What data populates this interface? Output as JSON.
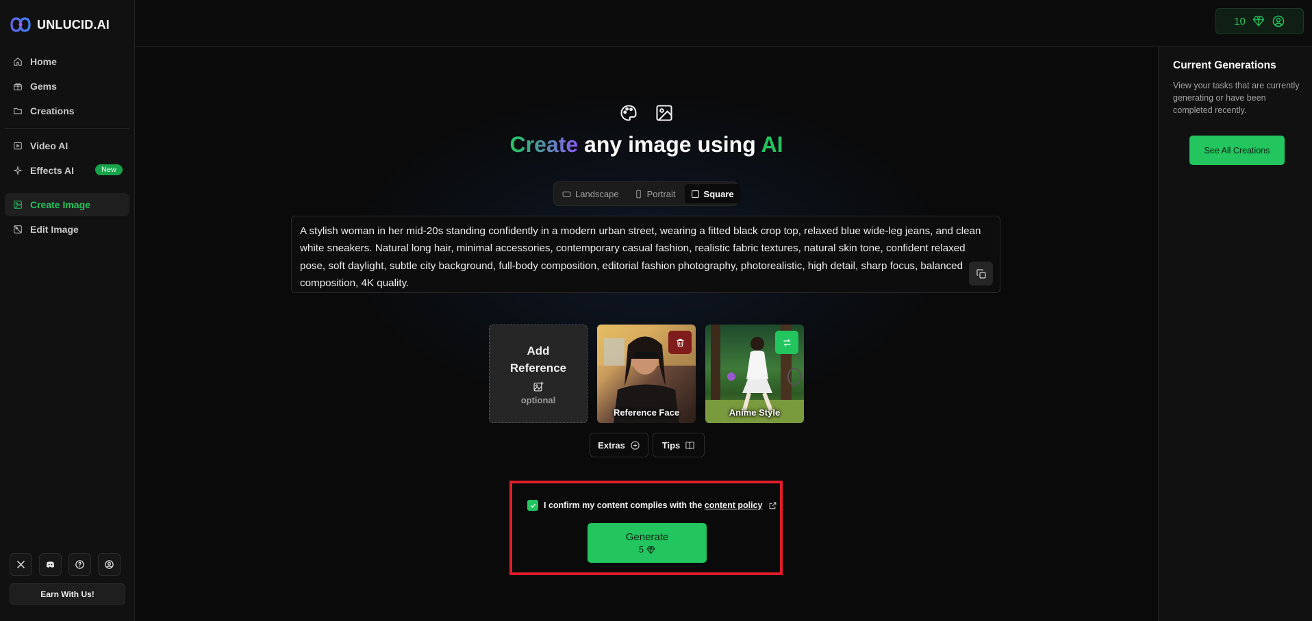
{
  "brand": {
    "name": "UNLUCID.AI"
  },
  "sidebar": {
    "items": [
      {
        "label": "Home",
        "icon": "home-icon"
      },
      {
        "label": "Gems",
        "icon": "gift-icon"
      },
      {
        "label": "Creations",
        "icon": "folder-icon"
      },
      {
        "label": "Video AI",
        "icon": "video-icon"
      },
      {
        "label": "Effects AI",
        "icon": "sparkles-icon",
        "badge": "New"
      },
      {
        "label": "Create Image",
        "icon": "image-plus-icon",
        "active": true
      },
      {
        "label": "Edit Image",
        "icon": "image-edit-icon"
      }
    ],
    "footer_icons": [
      "x-icon",
      "discord-icon",
      "help-icon",
      "user-icon"
    ],
    "earn_label": "Earn With Us!"
  },
  "topbar": {
    "gems_count": "10"
  },
  "main": {
    "headline": {
      "part1": "Create",
      "part2": " any image using ",
      "part3": "AI"
    },
    "aspect": {
      "options": [
        "Landscape",
        "Portrait",
        "Square"
      ],
      "selected": "Square"
    },
    "prompt": "A stylish woman in her mid-20s standing confidently in a modern urban street, wearing a fitted black crop top, relaxed blue wide-leg jeans, and clean white sneakers. Natural long hair, minimal accessories, contemporary casual fashion, realistic fabric textures, natural skin tone, confident relaxed pose, soft daylight, subtle city background, full-body composition, editorial fashion photography, photorealistic, high detail, sharp focus, balanced composition, 4K quality.",
    "reference": {
      "add_line1": "Add",
      "add_line2": "Reference",
      "optional": "optional"
    },
    "ref_cards": [
      {
        "label": "Reference Face"
      },
      {
        "label": "Anime Style"
      }
    ],
    "extras_label": "Extras",
    "tips_label": "Tips",
    "confirm": {
      "checked": true,
      "text": "I confirm my content complies with the ",
      "link": "content policy"
    },
    "generate": {
      "label": "Generate",
      "cost": "5"
    }
  },
  "right_panel": {
    "title": "Current Generations",
    "description": "View your tasks that are currently generating or have been completed recently.",
    "button": "See All Creations"
  },
  "colors": {
    "accent": "#22c55e",
    "highlight_frame": "#e11d2a",
    "delete": "#7f1d1d"
  }
}
